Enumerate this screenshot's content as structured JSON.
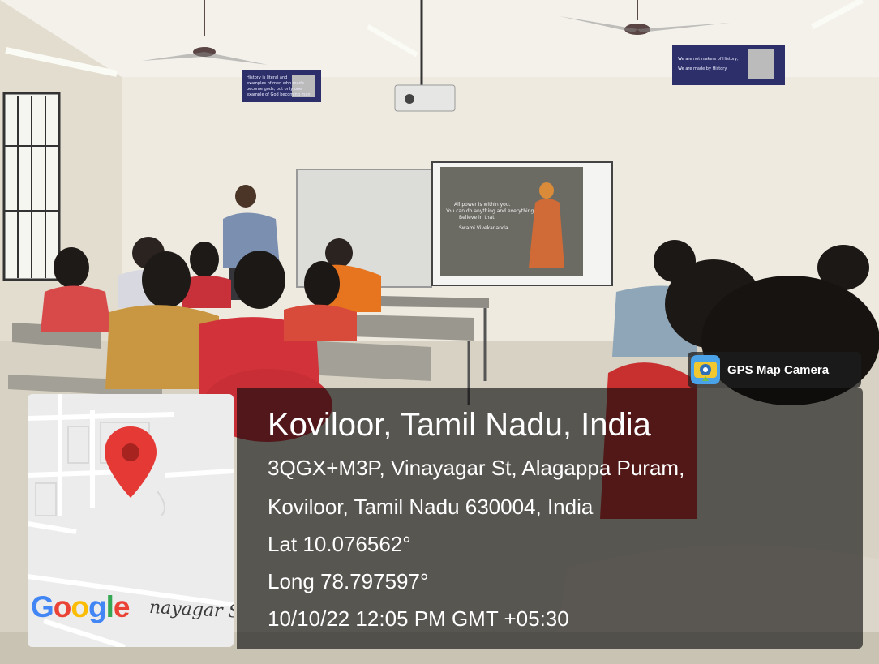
{
  "badge": {
    "label": "GPS Map Camera",
    "icon": "gps-map-camera-logo-icon"
  },
  "location": {
    "title": "Koviloor, Tamil Nadu, India",
    "address_line1": "3QGX+M3P, Vinayagar St, Alagappa Puram,",
    "address_line2": "Koviloor, Tamil Nadu 630004, India",
    "latitude": "Lat 10.076562°",
    "longitude": "Long 78.797597°",
    "timestamp": "10/10/22 12:05 PM GMT +05:30"
  },
  "map": {
    "brand": {
      "g1": "G",
      "o1": "o",
      "o2": "o",
      "g2": "g",
      "l": "l",
      "e": "e"
    },
    "street": "nayagar St",
    "pin_icon": "map-pin-icon",
    "pin_color": "#e53935"
  },
  "scene": {
    "quote_left": [
      "History is literal and",
      "examples of men who made",
      "become gods, but only one",
      "example of God becoming man."
    ],
    "quote_right": [
      "We are not makers of History,",
      "We are made by History."
    ],
    "slide": {
      "quote": [
        "All power is within you.",
        "You can do anything and everything.",
        "Believe in that."
      ],
      "author": "Swami Vivekananda"
    }
  },
  "colors": {
    "wall": "#eeeae0",
    "panel_bg": "#1a1a1a",
    "badge_bg": "#2a2a2a",
    "google_blue": "#4285F4",
    "google_red": "#EA4335",
    "google_yellow": "#FBBC05",
    "google_green": "#34A853"
  }
}
